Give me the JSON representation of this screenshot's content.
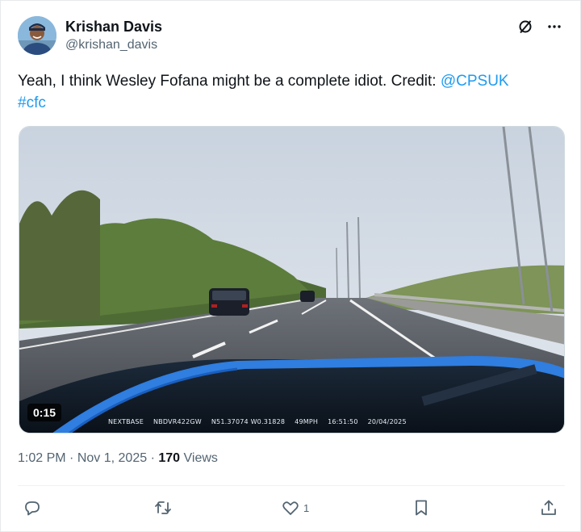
{
  "author": {
    "display_name": "Krishan Davis",
    "handle": "@krishan_davis",
    "avatar_icon": "person-avatar"
  },
  "header_icons": [
    "grok-icon",
    "more-icon"
  ],
  "tweet": {
    "text": "Yeah, I think Wesley Fofana might be a complete idiot. Credit: ",
    "mention": "@CPSUK",
    "hashtag": "#cfc"
  },
  "video": {
    "duration": "0:15",
    "overlay": {
      "brand": "NEXTBASE",
      "plate": "NBDVR422GW",
      "coords": "N51.37074  W0.31828",
      "speed": "49MPH",
      "time": "16:51:50",
      "date": "20/04/2025"
    }
  },
  "meta": {
    "time": "1:02 PM",
    "separator": "·",
    "date": "Nov 1, 2025",
    "views_count": "170",
    "views_label": "Views"
  },
  "actions": {
    "reply_count": "",
    "retweet_count": "",
    "like_count": "1"
  },
  "colors": {
    "link": "#1d9bf0",
    "secondary_text": "#536471",
    "primary_text": "#0f1419"
  }
}
